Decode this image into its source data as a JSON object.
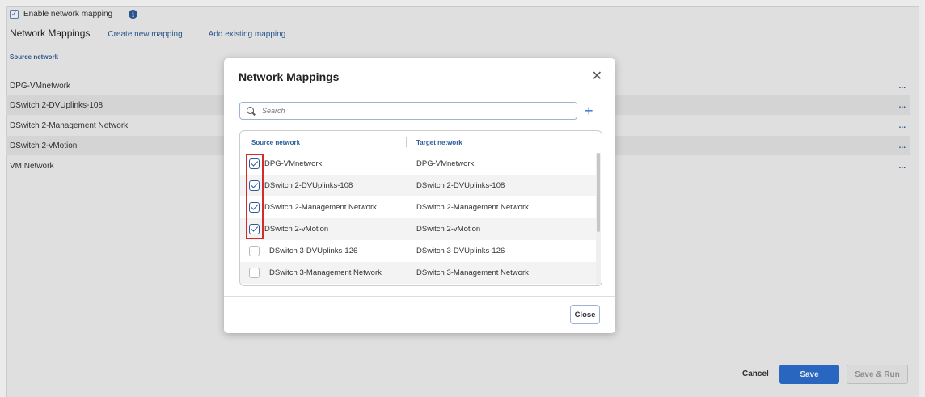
{
  "page": {
    "enable_label": "Enable network mapping",
    "title": "Network Mappings",
    "create_link": "Create new mapping",
    "add_link": "Add existing mapping",
    "source_header": "Source network",
    "rows": [
      {
        "name": "DPG-VMnetwork",
        "more": "..."
      },
      {
        "name": "DSwitch 2-DVUplinks-108",
        "more": "..."
      },
      {
        "name": "DSwitch 2-Management Network",
        "more": "..."
      },
      {
        "name": "DSwitch 2-vMotion",
        "more": "..."
      },
      {
        "name": "VM Network",
        "more": "..."
      }
    ],
    "footer": {
      "cancel": "Cancel",
      "save": "Save",
      "save_run": "Save & Run"
    }
  },
  "modal": {
    "title": "Network Mappings",
    "search_placeholder": "Search",
    "columns": {
      "source": "Source network",
      "target": "Target network"
    },
    "rows": [
      {
        "source": "DPG-VMnetwork",
        "target": "DPG-VMnetwork",
        "checked": true
      },
      {
        "source": "DSwitch 2-DVUplinks-108",
        "target": "DSwitch 2-DVUplinks-108",
        "checked": true
      },
      {
        "source": "DSwitch 2-Management Network",
        "target": "DSwitch 2-Management Network",
        "checked": true
      },
      {
        "source": "DSwitch 2-vMotion",
        "target": "DSwitch 2-vMotion",
        "checked": true
      },
      {
        "source": "DSwitch 3-DVUplinks-126",
        "target": "DSwitch 3-DVUplinks-126",
        "checked": false
      },
      {
        "source": "DSwitch 3-Management Network",
        "target": "DSwitch 3-Management Network",
        "checked": false
      }
    ],
    "close_button": "Close"
  },
  "icons": {
    "close": "close-icon",
    "search": "search-icon",
    "add": "plus-icon",
    "info": "info-icon"
  },
  "colors": {
    "accent": "#2c6fd1",
    "link": "#2c5c99",
    "highlight": "#d62b2b"
  }
}
